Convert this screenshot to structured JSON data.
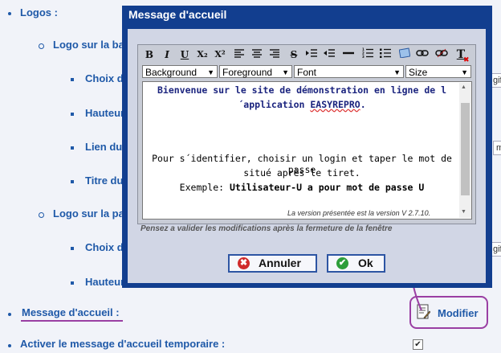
{
  "background": {
    "items": [
      {
        "label": "Logos :"
      },
      {
        "label": "Logo sur la ba"
      },
      {
        "label": "Choix d"
      },
      {
        "label": "Hauteur"
      },
      {
        "label": "Lien du"
      },
      {
        "label": "Titre du"
      },
      {
        "label": "Logo sur la pa"
      },
      {
        "label": "Choix d"
      },
      {
        "label": "Hauteur"
      },
      {
        "label": "Message d'accueil :"
      },
      {
        "label": "Activer le message d'accueil temporaire :"
      }
    ],
    "field_snips": [
      "gif",
      "m",
      "gif"
    ],
    "modifier_label": "Modifier"
  },
  "dialog": {
    "title": "Message d'accueil",
    "toolbar": {
      "bold": "B",
      "italic": "I",
      "underline": "U",
      "subscript": "X₂",
      "superscript": "X²",
      "strike": "S",
      "textcolor": "T"
    },
    "selects": [
      {
        "value": "Background"
      },
      {
        "value": "Foreground"
      },
      {
        "value": "Font"
      },
      {
        "value": "Size"
      }
    ],
    "content": {
      "line1": "Bienvenue sur le site de démonstration en ligne de l",
      "line2a": "´application ",
      "line2b": "EASYREPRO",
      "line2c": ".",
      "line3": "Pour s´identifier, choisir un login et taper le mot de passe",
      "line4": "situé après le tiret.",
      "line5a": "Exemple: ",
      "line5b": "Utilisateur-U a pour mot de passe U",
      "version": "La version présentée est la version V 2.7.10."
    },
    "hint": "Pensez a valider les modifications après la fermeture de la fenêtre",
    "cancel_label": "Annuler",
    "ok_label": "Ok"
  },
  "colors": {
    "accent": "#1f59a8",
    "dialog_frame": "#123e8f",
    "annotation": "#9a3fa3"
  }
}
